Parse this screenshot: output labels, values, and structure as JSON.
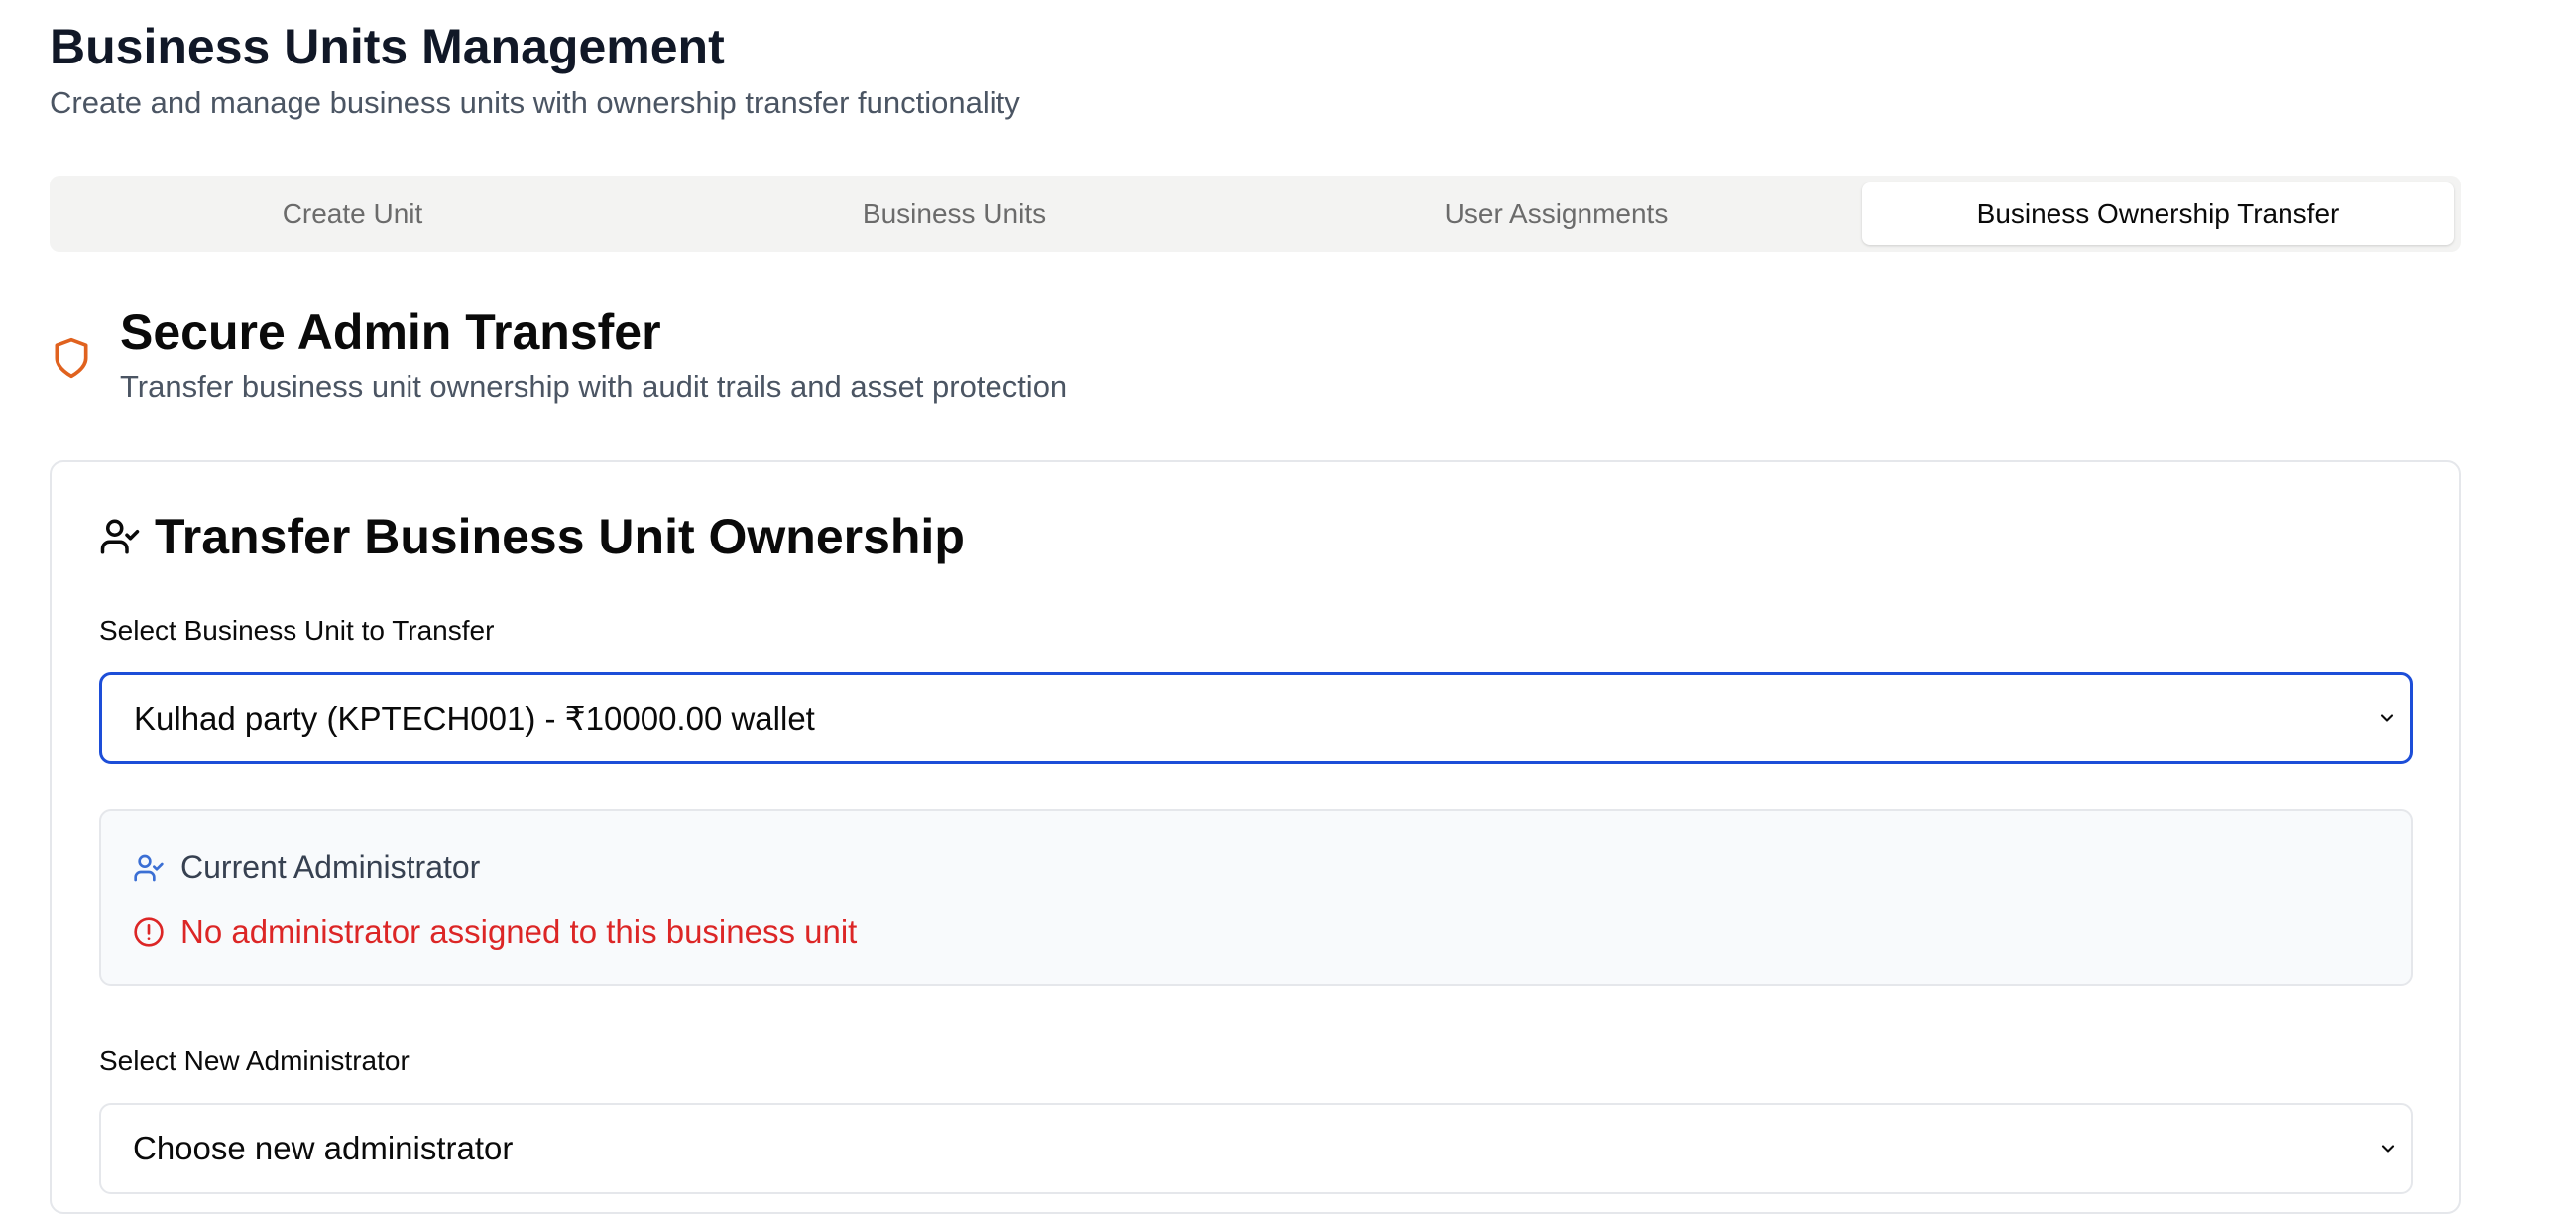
{
  "header": {
    "title": "Business Units Management",
    "subtitle": "Create and manage business units with ownership transfer functionality"
  },
  "tabs": [
    {
      "label": "Create Unit",
      "active": false
    },
    {
      "label": "Business Units",
      "active": false
    },
    {
      "label": "User Assignments",
      "active": false
    },
    {
      "label": "Business Ownership Transfer",
      "active": true
    }
  ],
  "section": {
    "icon": "shield-icon",
    "title": "Secure Admin Transfer",
    "subtitle": "Transfer business unit ownership with audit trails and asset protection"
  },
  "card": {
    "icon": "user-check-icon",
    "title": "Transfer Business Unit Ownership",
    "unit_select": {
      "label": "Select Business Unit to Transfer",
      "value": "Kulhad party (KPTECH001) - ₹10000.00 wallet"
    },
    "current_admin": {
      "heading": "Current Administrator",
      "warning": "No administrator assigned to this business unit"
    },
    "new_admin_select": {
      "label": "Select New Administrator",
      "placeholder": "Choose new administrator"
    }
  },
  "colors": {
    "accent_orange": "#e0621f",
    "focus_blue": "#1d4ed8",
    "icon_blue": "#3b6fd4",
    "error_red": "#dc2626"
  }
}
